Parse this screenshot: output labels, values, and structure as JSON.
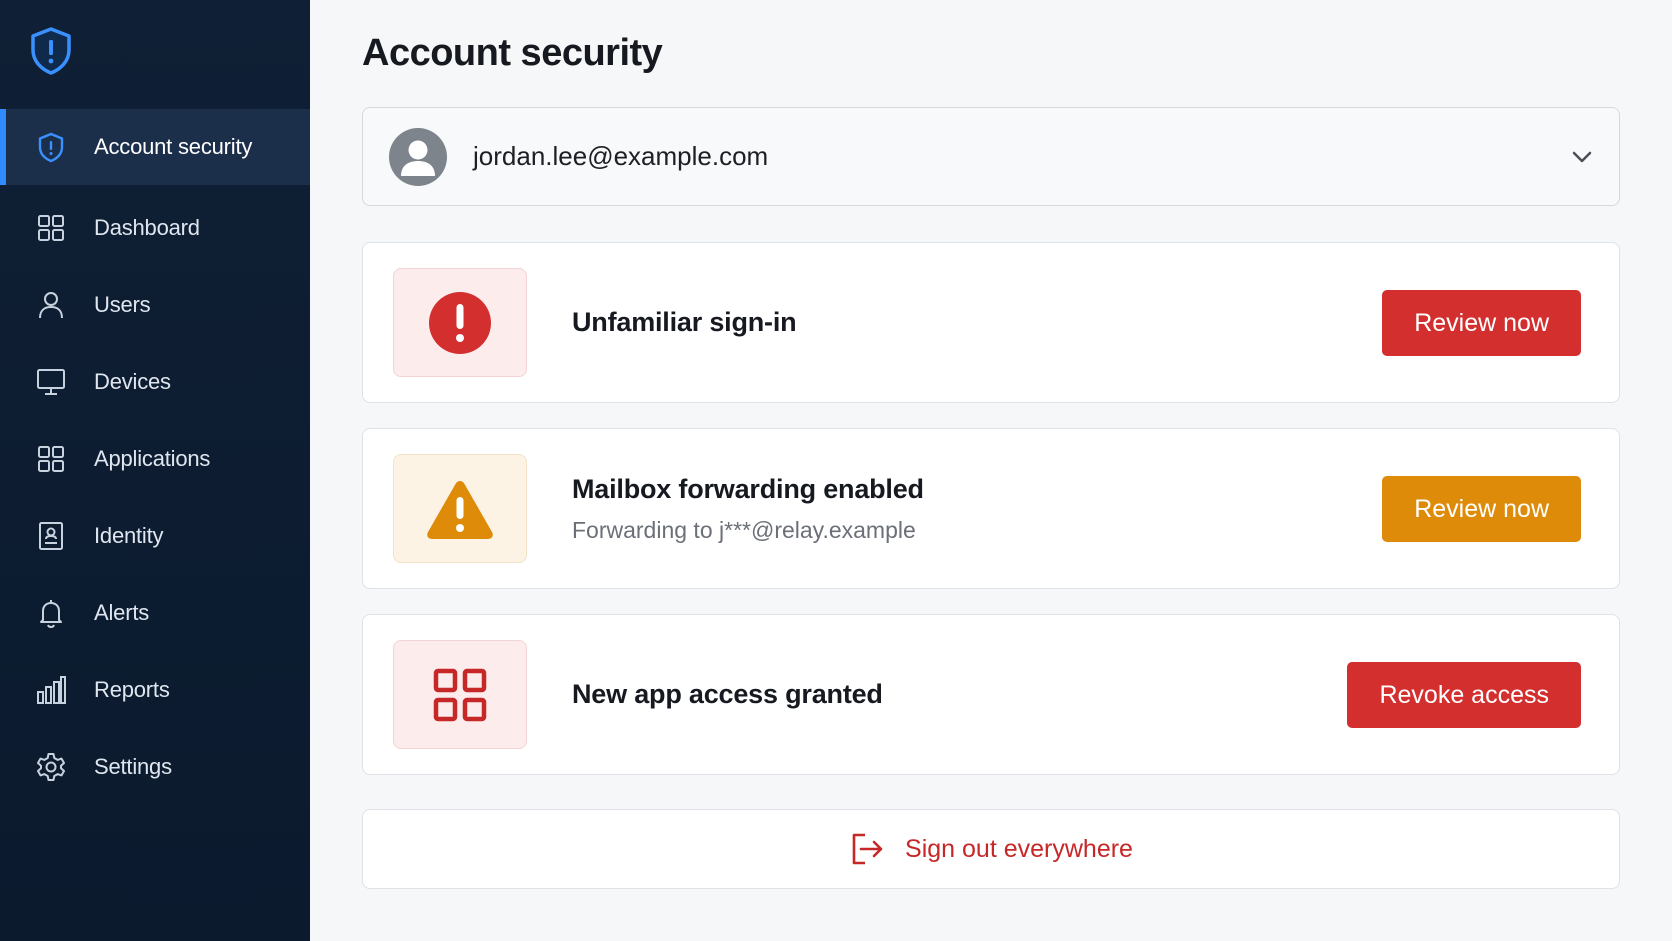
{
  "sidebar": {
    "items": [
      {
        "label": "Account security",
        "icon": "shield-icon",
        "active": true
      },
      {
        "label": "Dashboard",
        "icon": "dashboard-grid-icon"
      },
      {
        "label": "Users",
        "icon": "user-icon"
      },
      {
        "label": "Devices",
        "icon": "monitor-icon"
      },
      {
        "label": "Applications",
        "icon": "apps-grid-icon"
      },
      {
        "label": "Identity",
        "icon": "id-card-icon"
      },
      {
        "label": "Alerts",
        "icon": "bell-icon"
      },
      {
        "label": "Reports",
        "icon": "bar-chart-icon"
      },
      {
        "label": "Settings",
        "icon": "gear-icon"
      }
    ]
  },
  "main": {
    "title": "Account security",
    "account": {
      "email": "jordan.lee@example.com"
    },
    "alerts": [
      {
        "title": "Unfamiliar sign-in",
        "subtitle": "",
        "action": "Review now",
        "severity": "critical",
        "icon": "exclamation-circle-icon"
      },
      {
        "title": "Mailbox forwarding enabled",
        "subtitle": "Forwarding to j***@relay.example",
        "action": "Review now",
        "severity": "warning",
        "icon": "warning-triangle-icon"
      },
      {
        "title": "New app access granted",
        "subtitle": "",
        "action": "Revoke access",
        "severity": "critical",
        "icon": "apps-grid-icon"
      }
    ],
    "signout": {
      "label": "Sign out everywhere",
      "icon": "sign-out-icon"
    }
  },
  "colors": {
    "sidebar_bg": "#0f1f35",
    "active_accent": "#2f8bff",
    "danger": "#d32f2f",
    "warning": "#df8b0a"
  }
}
